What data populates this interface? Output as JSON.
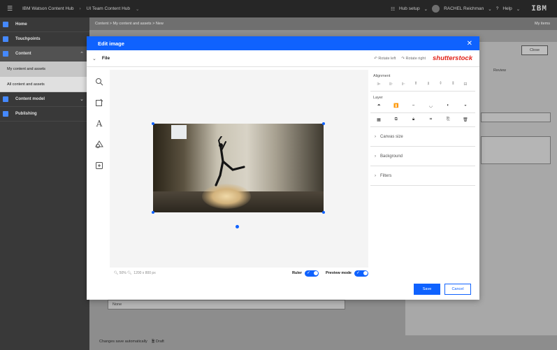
{
  "topbar": {
    "brand": "IBM Watson Content Hub",
    "hub": "UI Team Content Hub",
    "hub_setup": "Hub setup",
    "user": "RACHEL Reichman",
    "help": "Help",
    "logo": "IBM"
  },
  "sidebar": {
    "items": [
      {
        "label": "Home"
      },
      {
        "label": "Touchpoints"
      },
      {
        "label": "Content"
      },
      {
        "label": "My content and assets"
      },
      {
        "label": "All content and assets"
      },
      {
        "label": "Content model"
      },
      {
        "label": "Publishing"
      }
    ]
  },
  "background": {
    "breadcrumb": "Content  >  My content and assets  >  New",
    "my_items": "My items",
    "close_label": "Close",
    "review_label": "Review",
    "field_value": "None",
    "footer_text": "Changes save automatically",
    "footer_draft": "Draft"
  },
  "modal": {
    "title": "Edit image",
    "close_glyph": "✕",
    "file_label": "File",
    "rotate_left": "Rotate left",
    "rotate_right": "Rotate right",
    "shutterstock": "shutterstock",
    "zoom_text": "50%",
    "dimensions": "1200 x 800 px",
    "ruler_label": "Ruler",
    "preview_label": "Preview mode",
    "alignment_title": "Alignment",
    "layer_title": "Layer",
    "canvas_size": "Canvas size",
    "background": "Background",
    "filters": "Filters",
    "save_label": "Save",
    "cancel_label": "Cancel"
  },
  "colors": {
    "accent": "#0f62fe",
    "shutterstock_red": "#e2231a",
    "topbar": "#262626",
    "sidebar": "#393939"
  }
}
